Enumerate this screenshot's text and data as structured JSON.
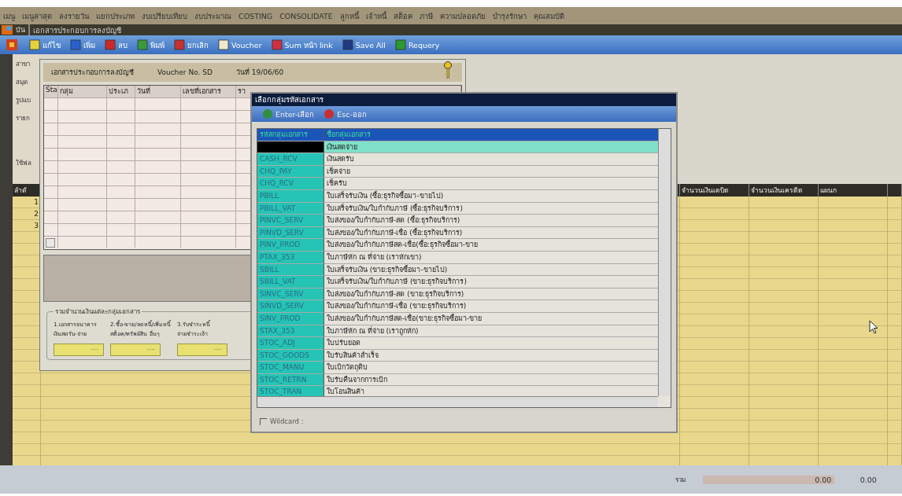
{
  "menu_bar": [
    "เมนู",
    "เมนูล่าสุด",
    "ลงรายวัน",
    "แยกประเภท",
    "งบเปรียบเทียบ",
    "งบประมาณ",
    "COSTING",
    "CONSOLIDATE",
    "ลูกหนี้",
    "เจ้าหนี้",
    "สต็อค",
    "ภาษี",
    "ความปลอดภัย",
    "บำรุงรักษา",
    "คุณสมบัติ"
  ],
  "window": {
    "title_cut": "บัน",
    "title": "เอกสารประกอบการลงบัญชี"
  },
  "toolbar": [
    {
      "label": "แก้ไข",
      "kind": "edit"
    },
    {
      "label": "เพิ่ม",
      "kind": "add"
    },
    {
      "label": "ลบ",
      "kind": "delete"
    },
    {
      "label": "พิมพ์",
      "kind": "print"
    },
    {
      "label": "ยกเลิก",
      "kind": "cancel"
    },
    {
      "label": "Voucher",
      "kind": "doc"
    },
    {
      "label": "Sum หน้า link",
      "kind": "sum"
    },
    {
      "label": "Save All",
      "kind": "save"
    },
    {
      "label": "Requery",
      "kind": "requery"
    }
  ],
  "form_labels": [
    "สาขา",
    "สมุด",
    "รูปแบ",
    "รายก",
    "ใช้ฟล"
  ],
  "panel": {
    "header": "เอกสารประกอบการลงบัญชี",
    "voucher": "Voucher No. SD",
    "date": "วันที่ 19/06/60",
    "columns": [
      "Sta",
      "กลุ่ม",
      "ประเภ",
      "วันที่",
      "เลขที่เอกสาร",
      "รา"
    ],
    "group_title": "รวมจำนวนเงินแต่ละกลุ่มเอกสาร",
    "groups": [
      {
        "line1": "1.เอกสารธนาคาร",
        "line2": "เงินสดรับ-จ่าย",
        "value": "...."
      },
      {
        "line1": "2.ซื้อ-ขาย/ลดหนี้/เพิ่มหนี้",
        "line2": "สต็อค/ทรัพย์สิน อื่นๆ",
        "value": "...."
      },
      {
        "line1": "3.รับชำระหนี้",
        "line2": "จ่ายชำระเจ้า",
        "value": "...."
      }
    ]
  },
  "lower_grid": {
    "columns": [
      "ลำดั",
      "จำนวนเงินเดบิต",
      "จำนวนเงินเครดิต",
      "แผนก"
    ],
    "row_numbers": [
      "1",
      "2",
      "3"
    ]
  },
  "footer": {
    "label": "รวม",
    "debit": "0.00",
    "credit": "0.00"
  },
  "dialog": {
    "title": "เลือกกลุ่มรหัสเอกสาร",
    "buttons": [
      {
        "label": "Enter-เลือก",
        "kind": "ok"
      },
      {
        "label": "Esc-ออก",
        "kind": "exit"
      }
    ],
    "columns": [
      "รหัสกลุ่มเอกสาร",
      "ชื่อกลุ่มเอกสาร"
    ],
    "rows": [
      {
        "code": "",
        "name": "เงินสดจ่าย",
        "selected": true
      },
      {
        "code": "CASH_RCV",
        "name": "เงินสดรับ",
        "selected": false
      },
      {
        "code": "CHQ_PAY",
        "name": "เช็คจ่าย",
        "selected": false
      },
      {
        "code": "CHQ_RCV",
        "name": "เช็ครับ",
        "selected": false
      },
      {
        "code": "PBILL",
        "name": "ใบเสร็จรับเงิน (ซื้อ:ธุรกิจซื้อมา-ขายไป)",
        "selected": false
      },
      {
        "code": "PBILL_VAT",
        "name": "ใบเสร็จรับเงิน/ใบกำกับภาษี (ซื้อ:ธุรกิจบริการ)",
        "selected": false
      },
      {
        "code": "PINVC_SERV",
        "name": "ใบส่งของ/ใบกำกับภาษี-สด (ซื้อ:ธุรกิจบริการ)",
        "selected": false
      },
      {
        "code": "PINVD_SERV",
        "name": "ใบส่งของ/ใบกำกับภาษี-เชื่อ (ซื้อ:ธุรกิจบริการ)",
        "selected": false
      },
      {
        "code": "PINV_PROD",
        "name": "ใบส่งของ/ใบกำกับภาษีสด-เชื่อ(ซื้อ:ธุรกิจซื้อมา-ขาย",
        "selected": false
      },
      {
        "code": "PTAX_353",
        "name": "ใบภาษีหัก ณ ที่จ่าย (เราหักเขา)",
        "selected": false
      },
      {
        "code": "SBILL",
        "name": "ใบเสร็จรับเงิน (ขาย:ธุรกิจซื้อมา-ขายไป)",
        "selected": false
      },
      {
        "code": "SBILL_VAT",
        "name": "ใบเสร็จรับเงิน/ใบกำกับภาษี (ขาย:ธุรกิจบริการ)",
        "selected": false
      },
      {
        "code": "SINVC_SERV",
        "name": "ใบส่งของ/ใบกำกับภาษี-สด (ขาย:ธุรกิจบริการ)",
        "selected": false
      },
      {
        "code": "SINVD_SERV",
        "name": "ใบส่งของ/ใบกำกับภาษี-เชื่อ (ขาย:ธุรกิจบริการ)",
        "selected": false
      },
      {
        "code": "SINV_PROD",
        "name": "ใบส่งของ/ใบกำกับภาษีสด-เชื่อ(ขาย:ธุรกิจซื้อมา-ขาย",
        "selected": false
      },
      {
        "code": "STAX_353",
        "name": "ใบภาษีหัก ณ ที่จ่าย (เราถูกหัก)",
        "selected": false
      },
      {
        "code": "STOC_ADJ",
        "name": "ใบปรับยอด",
        "selected": false
      },
      {
        "code": "STOC_GOODS",
        "name": "ใบรับสินค้าสำเร็จ",
        "selected": false
      },
      {
        "code": "STOC_MANU",
        "name": "ใบเบิกวัตถุดิบ",
        "selected": false
      },
      {
        "code": "STOC_RETRN",
        "name": "ใบรับคืนจากการเบิก",
        "selected": false
      },
      {
        "code": "STOC_TRAN",
        "name": "ใบโอนสินค้า",
        "selected": false
      }
    ],
    "wildcard": {
      "label": "Wildcard :",
      "checked": false
    }
  }
}
